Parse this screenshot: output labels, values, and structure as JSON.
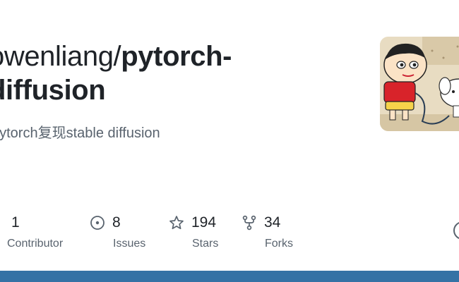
{
  "repo": {
    "owner": "owenliang",
    "separator": "/",
    "name_part1": "pytorch-",
    "name_part2": "diffusion",
    "description": "pytorch复现stable diffusion"
  },
  "avatar": {
    "icon": "avatar-cartoon-image"
  },
  "stats": [
    {
      "value": "1",
      "label": "Contributor",
      "icon": "people-icon"
    },
    {
      "value": "8",
      "label": "Issues",
      "icon": "issue-opened-icon"
    },
    {
      "value": "194",
      "label": "Stars",
      "icon": "star-icon"
    },
    {
      "value": "34",
      "label": "Forks",
      "icon": "repo-forked-icon"
    }
  ],
  "colors": {
    "language_bar": "#3572a5",
    "title": "#1f2328",
    "muted": "#59636e"
  }
}
